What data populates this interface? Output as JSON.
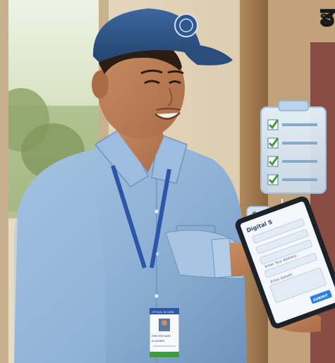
{
  "headline": {
    "text": "ਡ"
  },
  "tablet": {
    "title": "Digital S",
    "field_caption": "Enter Your Address",
    "field_caption_2": "Enter Details",
    "submit_label": "SUBMIT"
  },
  "badge": {
    "header": "OFFICIAL ID CARD",
    "name_line": "EMPLOYEE NAME",
    "id_line": "ID NUMBER"
  },
  "colors": {
    "shirt": "#8fb4d8",
    "cap": "#2e5486",
    "lanyard": "#2c57a8",
    "check": "#3c9e3a",
    "headline": "#f5d90a",
    "submit": "#2f7de0"
  },
  "icons": [
    "cap-emblem-icon",
    "clipboard-icon",
    "checkbox-icon",
    "phone-icon",
    "arrow-icon"
  ]
}
